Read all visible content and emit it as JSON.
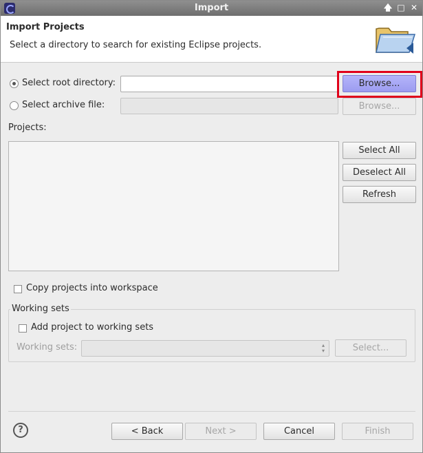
{
  "window": {
    "title": "Import"
  },
  "header": {
    "title": "Import Projects",
    "description": "Select a directory to search for existing Eclipse projects."
  },
  "source": {
    "root_label": "Select root directory:",
    "root_value": "",
    "root_browse": "Browse...",
    "archive_label": "Select archive file:",
    "archive_value": "",
    "archive_browse": "Browse..."
  },
  "projects": {
    "label": "Projects:",
    "items": [],
    "select_all": "Select All",
    "deselect_all": "Deselect All",
    "refresh": "Refresh"
  },
  "copy_projects_label": "Copy projects into workspace",
  "working_sets": {
    "group_label": "Working sets",
    "add_label": "Add project to working sets",
    "field_label": "Working sets:",
    "select_button": "Select..."
  },
  "footer": {
    "help": "?",
    "back": "< Back",
    "next": "Next >",
    "cancel": "Cancel",
    "finish": "Finish"
  },
  "colors": {
    "highlight": "#e0001a",
    "focused_button": "#a8a8f5"
  }
}
